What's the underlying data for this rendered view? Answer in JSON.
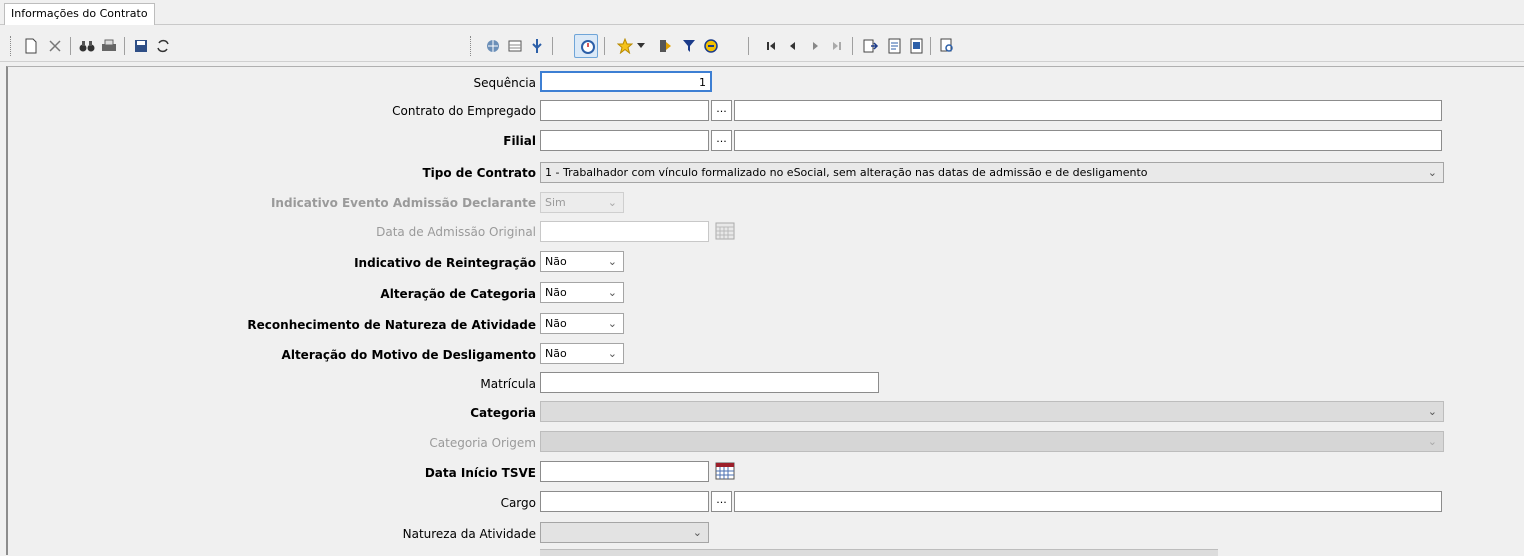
{
  "tab": {
    "label": "Informações do Contrato"
  },
  "toolbar": {
    "icons": [
      "new-document-icon",
      "delete-icon",
      "find-binoculars-icon",
      "print-icon",
      "save-icon",
      "refresh-icon",
      "globe-icon",
      "grid-icon",
      "info-icon",
      "timer-icon",
      "favorite-star-icon",
      "dropdown-arrow-icon",
      "exit-icon",
      "filter-icon",
      "record-icon",
      "first-record-icon",
      "previous-record-icon",
      "next-record-icon",
      "last-record-icon",
      "export-icon",
      "report-icon",
      "report2-icon",
      "preview-icon"
    ]
  },
  "form": {
    "sequencia": {
      "label": "Sequência",
      "value": "1"
    },
    "contrato_empregado": {
      "label": "Contrato do Empregado",
      "value": "",
      "desc": "",
      "lookup": "..."
    },
    "filial": {
      "label": "Filial",
      "value": "",
      "desc": "",
      "lookup": "..."
    },
    "tipo_contrato": {
      "label": "Tipo de Contrato",
      "value": "1 - Trabalhador com vínculo formalizado no eSocial, sem alteração nas datas de admissão e de desligamento"
    },
    "indicativo_evento": {
      "label": "Indicativo Evento Admissão Declarante",
      "value": "Sim"
    },
    "data_admissao_original": {
      "label": "Data de Admissão Original",
      "value": ""
    },
    "indicativo_reintegracao": {
      "label": "Indicativo de Reintegração",
      "value": "Não"
    },
    "alteracao_categoria": {
      "label": "Alteração de Categoria",
      "value": "Não"
    },
    "reconhecimento_natureza": {
      "label": "Reconhecimento de Natureza de Atividade",
      "value": "Não"
    },
    "alteracao_motivo": {
      "label": "Alteração do Motivo de Desligamento",
      "value": "Não"
    },
    "matricula": {
      "label": "Matrícula",
      "value": ""
    },
    "categoria": {
      "label": "Categoria",
      "value": ""
    },
    "categoria_origem": {
      "label": "Categoria Origem",
      "value": ""
    },
    "data_inicio_tsve": {
      "label": "Data Início TSVE",
      "value": ""
    },
    "cargo": {
      "label": "Cargo",
      "value": "",
      "desc": "",
      "lookup": "..."
    },
    "natureza_atividade": {
      "label": "Natureza da Atividade",
      "value": ""
    }
  },
  "colors": {
    "accent": "#3d7fd3",
    "background": "#f0f0f0"
  }
}
